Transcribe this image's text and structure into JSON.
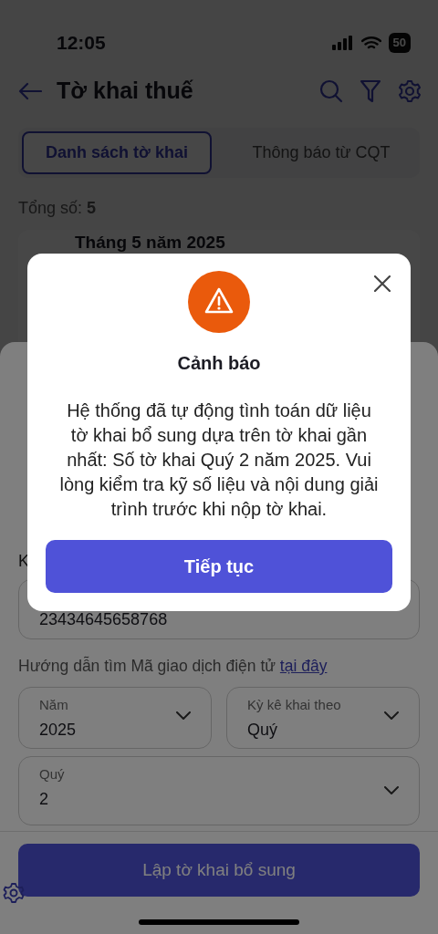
{
  "status_bar": {
    "time": "12:05",
    "battery": "50"
  },
  "header": {
    "title": "Tờ khai thuế"
  },
  "tabs": [
    {
      "label": "Danh sách tờ khai",
      "selected": true
    },
    {
      "label": "Thông báo từ CQT",
      "selected": false
    }
  ],
  "total": "Tổng số: **5**",
  "list_items": [
    {
      "title": "Tháng 5 năm 2025"
    }
  ],
  "sheet": {
    "section_label": "K",
    "transaction_code": {
      "value": "23434645658768"
    },
    "help": {
      "text": "Hướng dẫn tìm Mã giao dịch điện tử",
      "link": "tại đây"
    },
    "selects": [
      {
        "label": "Năm",
        "value": "2025"
      },
      {
        "label": "Kỳ kê khai theo",
        "value": "Quý"
      },
      {
        "label": "Quý",
        "value": "2"
      }
    ],
    "submit": "Lập tờ khai bổ sung"
  },
  "dialog": {
    "title": "Cảnh báo",
    "message": "Hệ thống đã tự động tình toán dữ liệu tờ khai bổ sung dựa trên tờ khai gần nhất: Số tờ khai Quý 2 năm 2025. Vui lòng kiểm tra kỹ số liệu và nội dung giải trình trước khi nộp tờ khai.",
    "button": "Tiếp tục"
  }
}
